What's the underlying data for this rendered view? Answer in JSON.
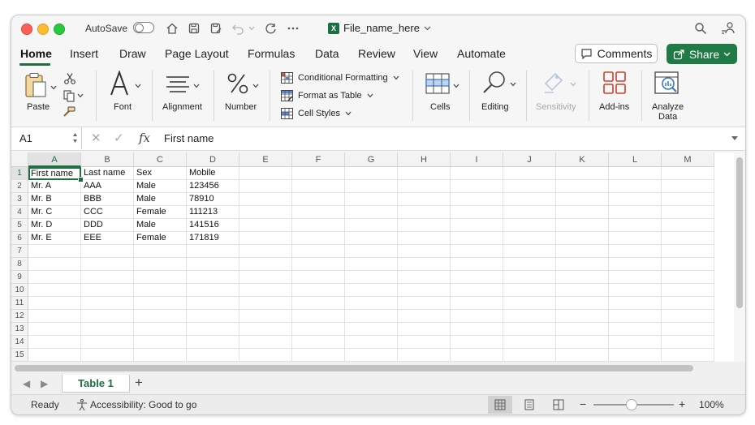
{
  "titlebar": {
    "autosave_label": "AutoSave",
    "file_name": "File_name_here",
    "file_badge": "X"
  },
  "tabs": [
    "Home",
    "Insert",
    "Draw",
    "Page Layout",
    "Formulas",
    "Data",
    "Review",
    "View",
    "Automate"
  ],
  "actions": {
    "comments_label": "Comments",
    "share_label": "Share"
  },
  "ribbon": {
    "paste_label": "Paste",
    "font_label": "Font",
    "alignment_label": "Alignment",
    "number_label": "Number",
    "conditional_formatting_label": "Conditional Formatting",
    "format_as_table_label": "Format as Table",
    "cell_styles_label": "Cell Styles",
    "cells_label": "Cells",
    "editing_label": "Editing",
    "sensitivity_label": "Sensitivity",
    "addins_label": "Add-ins",
    "analyze_label_1": "Analyze",
    "analyze_label_2": "Data"
  },
  "formula_bar": {
    "name_box": "A1",
    "fx": "fx",
    "content": "First name"
  },
  "columns": [
    "A",
    "B",
    "C",
    "D",
    "E",
    "F",
    "G",
    "H",
    "I",
    "J",
    "K",
    "L",
    "M"
  ],
  "rows": [
    "1",
    "2",
    "3",
    "4",
    "5",
    "6",
    "7",
    "8",
    "9",
    "10",
    "11",
    "12",
    "13",
    "14",
    "15"
  ],
  "cells": [
    [
      "First name",
      "Last name",
      "Sex",
      "Mobile"
    ],
    [
      "Mr. A",
      "AAA",
      "Male",
      "123456"
    ],
    [
      "Mr. B",
      "BBB",
      "Male",
      "78910"
    ],
    [
      "Mr. C",
      "CCC",
      "Female",
      "111213"
    ],
    [
      "Mr. D",
      "DDD",
      "Male",
      "141516"
    ],
    [
      "Mr. E",
      "EEE",
      "Female",
      "171819"
    ]
  ],
  "sheets": {
    "active": "Table 1",
    "add": "+"
  },
  "status": {
    "ready": "Ready",
    "accessibility": "Accessibility: Good to go",
    "zoom": "100%",
    "zoom_minus": "−",
    "zoom_plus": "+"
  },
  "colors": {
    "accent": "#1e6e3f",
    "share_bg": "#1f7a45"
  }
}
